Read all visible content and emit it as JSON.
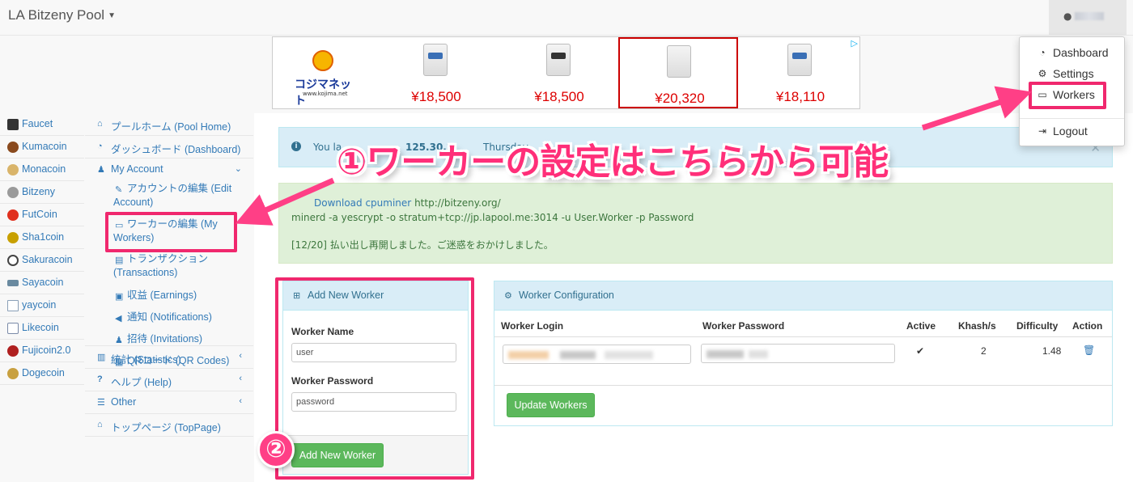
{
  "app": {
    "title": "LA Bitzeny Pool"
  },
  "ad": {
    "logo_text": "コジマネット",
    "logo_url": "www.kojima.net",
    "prices": [
      "¥18,500",
      "¥18,500",
      "¥20,320",
      "¥18,110"
    ]
  },
  "coins": [
    {
      "name": "Faucet",
      "color": "#333333"
    },
    {
      "name": "Kumacoin",
      "color": "#8a4a1e"
    },
    {
      "name": "Monacoin",
      "color": "#d9b46a"
    },
    {
      "name": "Bitzeny",
      "color": "#9a9a9a"
    },
    {
      "name": "FutCoin",
      "color": "#e0301e"
    },
    {
      "name": "Sha1coin",
      "color": "#c8a000"
    },
    {
      "name": "Sakuracoin",
      "color": "#444444"
    },
    {
      "name": "Sayacoin",
      "color": "#6a8aa0"
    },
    {
      "name": "yaycoin",
      "color": "#8aa0b8"
    },
    {
      "name": "Likecoin",
      "color": "#7a8aa8"
    },
    {
      "name": "Fujicoin2.0",
      "color": "#b02020"
    },
    {
      "name": "Dogecoin",
      "color": "#c8a040"
    }
  ],
  "sidebar": {
    "pool_home": "プールホーム (Pool Home)",
    "dashboard": "ダッシュボード (Dashboard)",
    "my_account": "My Account",
    "edit_account": "アカウントの編集 (Edit Account)",
    "my_workers": "ワーカーの編集 (My Workers)",
    "transactions": "トランザクション (Transactions)",
    "earnings": "収益 (Earnings)",
    "notifications": "通知 (Notifications)",
    "invitations": "招待 (Invitations)",
    "qr_codes": "QRコード (QR Codes)",
    "statistics": "統計 (Statistics)",
    "help": "ヘルプ (Help)",
    "other": "Other",
    "top_page": "トップページ (TopPage)"
  },
  "info_alert": {
    "prefix": "You la",
    "ip": "125.30.2",
    "suffix": "Thursday"
  },
  "success_alert": {
    "download_link": "Download cpuminer",
    "download_url": "http://bitzeny.org/",
    "command": "minerd -a yescrypt -o stratum+tcp://jp.lapool.me:3014 -u User.Worker -p Password",
    "notice": "[12/20] 払い出し再開しました。ご迷惑をおかけしました。"
  },
  "add_worker": {
    "title": "Add New Worker",
    "name_label": "Worker Name",
    "name_value": "user",
    "password_label": "Worker Password",
    "password_value": "password",
    "button": "Add New Worker"
  },
  "worker_config": {
    "title": "Worker Configuration",
    "columns": [
      "Worker Login",
      "Worker Password",
      "Active",
      "Khash/s",
      "Difficulty",
      "Action"
    ],
    "row": {
      "active": "✔",
      "khash": "2",
      "difficulty": "1.48"
    },
    "button": "Update Workers"
  },
  "user_menu": {
    "items": [
      "Dashboard",
      "Settings",
      "Workers",
      "Logout"
    ]
  },
  "annotations": {
    "step1_mark": "①",
    "step1": "ワーカーの設定はこちらから可能",
    "step2": "②"
  },
  "colors": {
    "highlight": "#f0286e",
    "link": "#337ab7",
    "success": "#5cb85c"
  }
}
